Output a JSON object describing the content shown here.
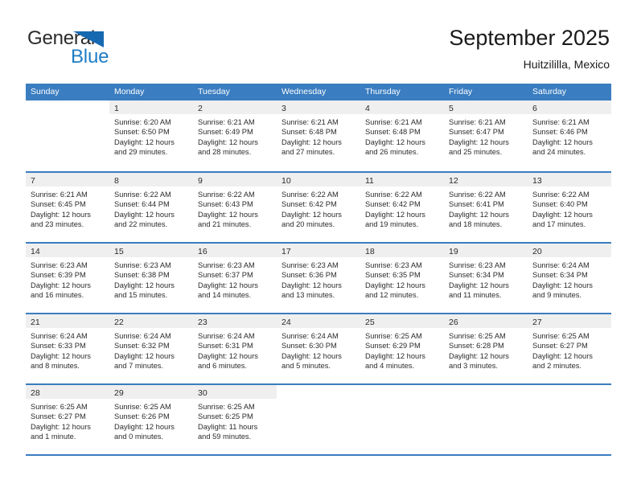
{
  "brand": {
    "name_primary": "General",
    "name_secondary": "Blue",
    "flag_icon": "flag-triangle-icon"
  },
  "header": {
    "title": "September 2025",
    "subtitle": "Huitzililla, Mexico"
  },
  "calendar": {
    "weekdays": [
      "Sunday",
      "Monday",
      "Tuesday",
      "Wednesday",
      "Thursday",
      "Friday",
      "Saturday"
    ],
    "accent_color": "#3a7dc0",
    "day_band_color": "#efefef",
    "weeks": [
      [
        {
          "date": "",
          "lines": []
        },
        {
          "date": "1",
          "lines": [
            "Sunrise: 6:20 AM",
            "Sunset: 6:50 PM",
            "Daylight: 12 hours",
            "and 29 minutes."
          ]
        },
        {
          "date": "2",
          "lines": [
            "Sunrise: 6:21 AM",
            "Sunset: 6:49 PM",
            "Daylight: 12 hours",
            "and 28 minutes."
          ]
        },
        {
          "date": "3",
          "lines": [
            "Sunrise: 6:21 AM",
            "Sunset: 6:48 PM",
            "Daylight: 12 hours",
            "and 27 minutes."
          ]
        },
        {
          "date": "4",
          "lines": [
            "Sunrise: 6:21 AM",
            "Sunset: 6:48 PM",
            "Daylight: 12 hours",
            "and 26 minutes."
          ]
        },
        {
          "date": "5",
          "lines": [
            "Sunrise: 6:21 AM",
            "Sunset: 6:47 PM",
            "Daylight: 12 hours",
            "and 25 minutes."
          ]
        },
        {
          "date": "6",
          "lines": [
            "Sunrise: 6:21 AM",
            "Sunset: 6:46 PM",
            "Daylight: 12 hours",
            "and 24 minutes."
          ]
        }
      ],
      [
        {
          "date": "7",
          "lines": [
            "Sunrise: 6:21 AM",
            "Sunset: 6:45 PM",
            "Daylight: 12 hours",
            "and 23 minutes."
          ]
        },
        {
          "date": "8",
          "lines": [
            "Sunrise: 6:22 AM",
            "Sunset: 6:44 PM",
            "Daylight: 12 hours",
            "and 22 minutes."
          ]
        },
        {
          "date": "9",
          "lines": [
            "Sunrise: 6:22 AM",
            "Sunset: 6:43 PM",
            "Daylight: 12 hours",
            "and 21 minutes."
          ]
        },
        {
          "date": "10",
          "lines": [
            "Sunrise: 6:22 AM",
            "Sunset: 6:42 PM",
            "Daylight: 12 hours",
            "and 20 minutes."
          ]
        },
        {
          "date": "11",
          "lines": [
            "Sunrise: 6:22 AM",
            "Sunset: 6:42 PM",
            "Daylight: 12 hours",
            "and 19 minutes."
          ]
        },
        {
          "date": "12",
          "lines": [
            "Sunrise: 6:22 AM",
            "Sunset: 6:41 PM",
            "Daylight: 12 hours",
            "and 18 minutes."
          ]
        },
        {
          "date": "13",
          "lines": [
            "Sunrise: 6:22 AM",
            "Sunset: 6:40 PM",
            "Daylight: 12 hours",
            "and 17 minutes."
          ]
        }
      ],
      [
        {
          "date": "14",
          "lines": [
            "Sunrise: 6:23 AM",
            "Sunset: 6:39 PM",
            "Daylight: 12 hours",
            "and 16 minutes."
          ]
        },
        {
          "date": "15",
          "lines": [
            "Sunrise: 6:23 AM",
            "Sunset: 6:38 PM",
            "Daylight: 12 hours",
            "and 15 minutes."
          ]
        },
        {
          "date": "16",
          "lines": [
            "Sunrise: 6:23 AM",
            "Sunset: 6:37 PM",
            "Daylight: 12 hours",
            "and 14 minutes."
          ]
        },
        {
          "date": "17",
          "lines": [
            "Sunrise: 6:23 AM",
            "Sunset: 6:36 PM",
            "Daylight: 12 hours",
            "and 13 minutes."
          ]
        },
        {
          "date": "18",
          "lines": [
            "Sunrise: 6:23 AM",
            "Sunset: 6:35 PM",
            "Daylight: 12 hours",
            "and 12 minutes."
          ]
        },
        {
          "date": "19",
          "lines": [
            "Sunrise: 6:23 AM",
            "Sunset: 6:34 PM",
            "Daylight: 12 hours",
            "and 11 minutes."
          ]
        },
        {
          "date": "20",
          "lines": [
            "Sunrise: 6:24 AM",
            "Sunset: 6:34 PM",
            "Daylight: 12 hours",
            "and 9 minutes."
          ]
        }
      ],
      [
        {
          "date": "21",
          "lines": [
            "Sunrise: 6:24 AM",
            "Sunset: 6:33 PM",
            "Daylight: 12 hours",
            "and 8 minutes."
          ]
        },
        {
          "date": "22",
          "lines": [
            "Sunrise: 6:24 AM",
            "Sunset: 6:32 PM",
            "Daylight: 12 hours",
            "and 7 minutes."
          ]
        },
        {
          "date": "23",
          "lines": [
            "Sunrise: 6:24 AM",
            "Sunset: 6:31 PM",
            "Daylight: 12 hours",
            "and 6 minutes."
          ]
        },
        {
          "date": "24",
          "lines": [
            "Sunrise: 6:24 AM",
            "Sunset: 6:30 PM",
            "Daylight: 12 hours",
            "and 5 minutes."
          ]
        },
        {
          "date": "25",
          "lines": [
            "Sunrise: 6:25 AM",
            "Sunset: 6:29 PM",
            "Daylight: 12 hours",
            "and 4 minutes."
          ]
        },
        {
          "date": "26",
          "lines": [
            "Sunrise: 6:25 AM",
            "Sunset: 6:28 PM",
            "Daylight: 12 hours",
            "and 3 minutes."
          ]
        },
        {
          "date": "27",
          "lines": [
            "Sunrise: 6:25 AM",
            "Sunset: 6:27 PM",
            "Daylight: 12 hours",
            "and 2 minutes."
          ]
        }
      ],
      [
        {
          "date": "28",
          "lines": [
            "Sunrise: 6:25 AM",
            "Sunset: 6:27 PM",
            "Daylight: 12 hours",
            "and 1 minute."
          ]
        },
        {
          "date": "29",
          "lines": [
            "Sunrise: 6:25 AM",
            "Sunset: 6:26 PM",
            "Daylight: 12 hours",
            "and 0 minutes."
          ]
        },
        {
          "date": "30",
          "lines": [
            "Sunrise: 6:25 AM",
            "Sunset: 6:25 PM",
            "Daylight: 11 hours",
            "and 59 minutes."
          ]
        },
        {
          "date": "",
          "lines": []
        },
        {
          "date": "",
          "lines": []
        },
        {
          "date": "",
          "lines": []
        },
        {
          "date": "",
          "lines": []
        }
      ]
    ]
  }
}
